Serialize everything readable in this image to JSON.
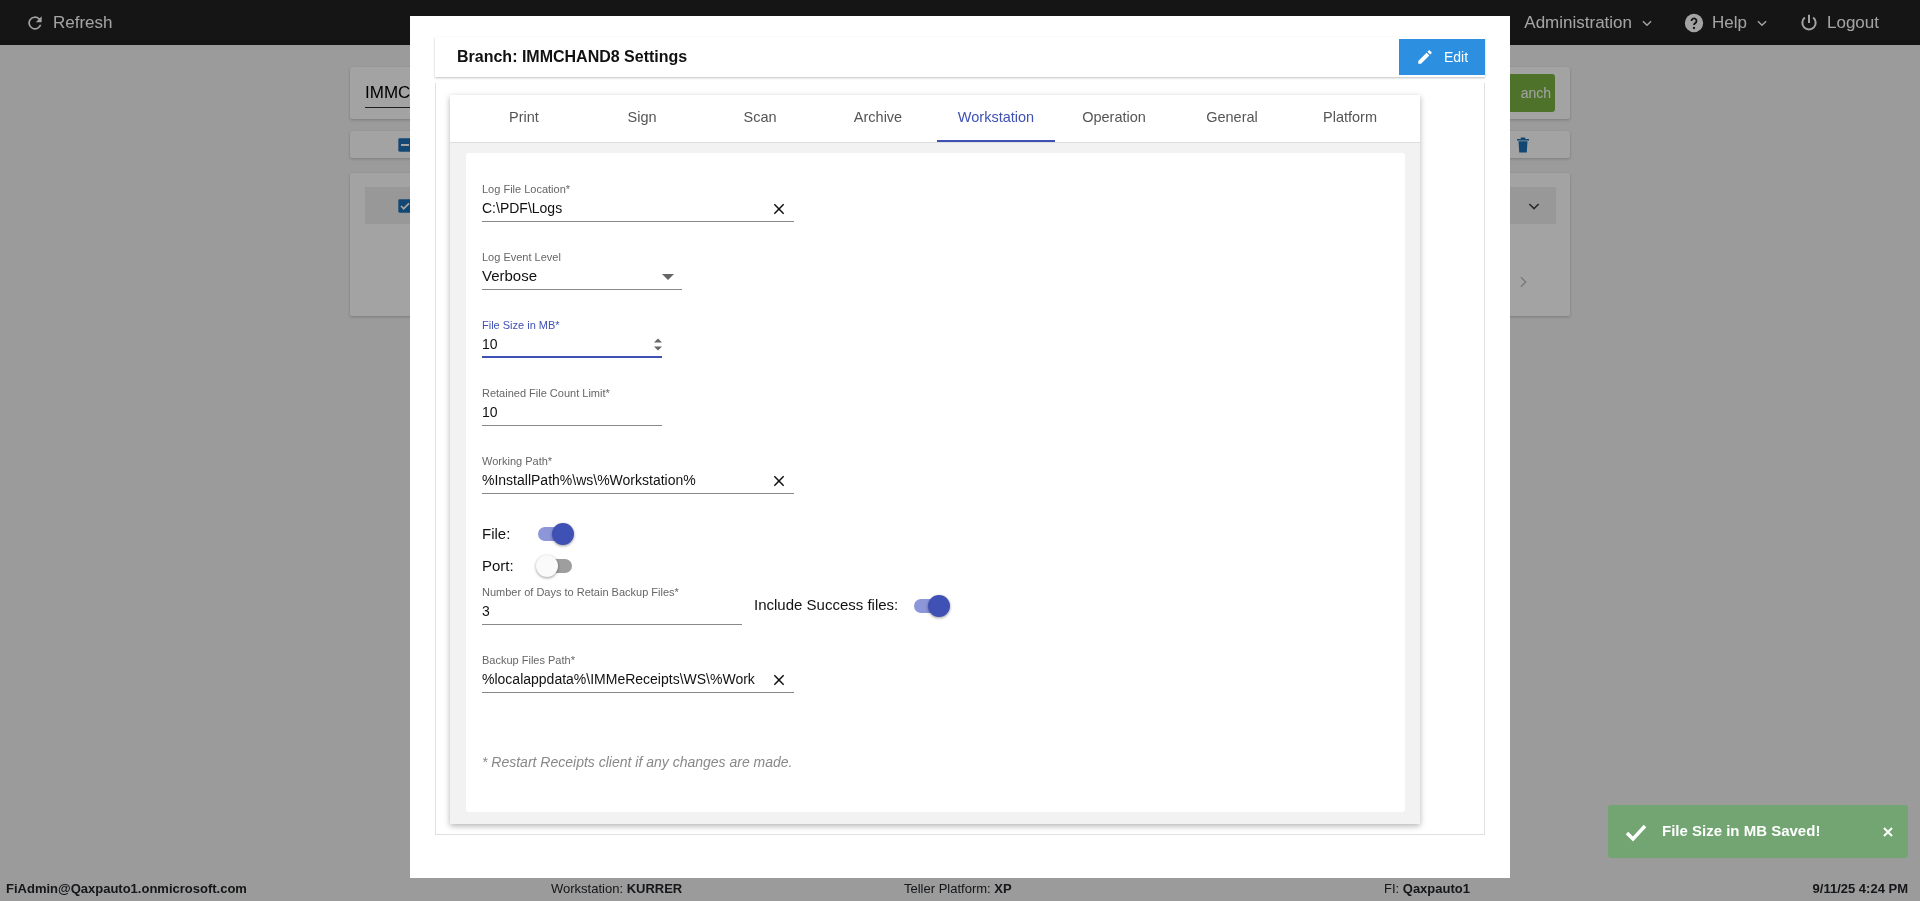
{
  "top_bar": {
    "refresh": "Refresh",
    "menus": [
      {
        "label": "Administration",
        "kind": "menu"
      },
      {
        "label": "Help",
        "kind": "help"
      }
    ],
    "logout": "Logout"
  },
  "background": {
    "search_value": "IMMC",
    "button": "anch",
    "select_all": {
      "indeterminate": true
    },
    "list_item": {
      "checked": true
    }
  },
  "modal": {
    "title": "Branch: IMMCHAND8 Settings",
    "edit_button": "Edit",
    "tabs": [
      {
        "label": "Print",
        "selected": false
      },
      {
        "label": "Sign",
        "selected": false
      },
      {
        "label": "Scan",
        "selected": false
      },
      {
        "label": "Archive",
        "selected": false
      },
      {
        "label": "Workstation",
        "selected": true
      },
      {
        "label": "Operation",
        "selected": false
      },
      {
        "label": "General",
        "selected": false
      },
      {
        "label": "Platform",
        "selected": false
      }
    ],
    "rows": [
      {
        "controls": [
          {
            "kind": "text",
            "label": "Log File Location*",
            "value": "C:\\PDF\\Logs",
            "clearable": true,
            "focused": false
          }
        ]
      },
      {
        "controls": [
          {
            "kind": "select",
            "label": "Log Event Level",
            "value": "Verbose",
            "focused": false
          }
        ]
      },
      {
        "controls": [
          {
            "kind": "number",
            "label": "File Size in MB*",
            "value": "10",
            "focused": true
          }
        ]
      },
      {
        "controls": [
          {
            "kind": "number",
            "label": "Retained File Count Limit*",
            "value": "10",
            "focused": false
          }
        ]
      },
      {
        "controls": [
          {
            "kind": "text",
            "label": "Working Path*",
            "value": "%InstallPath%\\ws\\%Workstation%",
            "clearable": true,
            "focused": false
          }
        ]
      },
      {
        "controls": [
          {
            "kind": "switch",
            "label": "File:",
            "on": true
          }
        ]
      },
      {
        "controls": [
          {
            "kind": "switch",
            "label": "Port:",
            "on": false
          }
        ]
      },
      {
        "controls": [
          {
            "kind": "number",
            "label": "Number of Days to Retain Backup Files*",
            "value": "3",
            "focused": false
          },
          {
            "kind": "switch",
            "label": "Include Success files:",
            "on": true
          }
        ]
      },
      {
        "controls": [
          {
            "kind": "text",
            "label": "Backup Files Path*",
            "value": "%localappdata%\\IMMeReceipts\\WS\\%Work",
            "clearable": true,
            "focused": false
          }
        ]
      }
    ],
    "note": "* Restart Receipts client if any changes are made."
  },
  "toast": {
    "message": "File Size in MB Saved!"
  },
  "status_bar": {
    "user": "FiAdmin@Qaxpauto1.onmicrosoft.com",
    "items": [
      {
        "label": "Workstation:",
        "value": "KURRER"
      },
      {
        "label": "Teller Platform:",
        "value": "XP"
      },
      {
        "label": "FI:",
        "value": "Qaxpauto1"
      }
    ],
    "datetime": "9/11/25 4:24 PM"
  }
}
